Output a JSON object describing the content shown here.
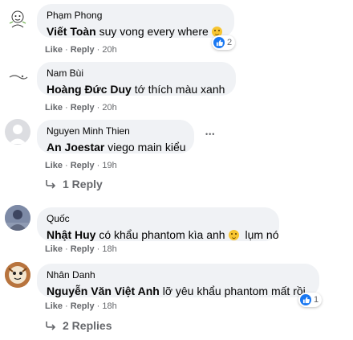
{
  "actions": {
    "like": "Like",
    "reply": "Reply",
    "separator": "·"
  },
  "comments": [
    {
      "author": "Phạm Phong",
      "mention": "Viết Toàn",
      "text": "suy vong every where",
      "time": "20h",
      "reaction_count": "2"
    },
    {
      "author": "Nam Bùi",
      "mention": "Hoàng Đức Duy",
      "text": "tớ thích màu xanh",
      "time": "20h"
    },
    {
      "author": "Nguyen Minh Thien",
      "mention": "An Joestar",
      "text": "viego main kiểu",
      "time": "19h",
      "more": "•••",
      "replies": "1 Reply"
    },
    {
      "author": "Quốc",
      "mention": "Nhật Huy",
      "text_before": "có khẩu phantom kìa anh",
      "text_after": "lụm nó",
      "time": "18h"
    },
    {
      "author": "Nhân Danh",
      "mention": "Nguyễn Văn Việt Anh",
      "text": "lỡ yêu khẩu phantom mất rồi",
      "time": "18h",
      "reaction_count": "1",
      "replies": "2 Replies"
    }
  ],
  "colors": {
    "bubble": "#f0f2f5",
    "meta": "#65676b",
    "like_blue": "#1877f2",
    "emoji": "#f7c531"
  }
}
